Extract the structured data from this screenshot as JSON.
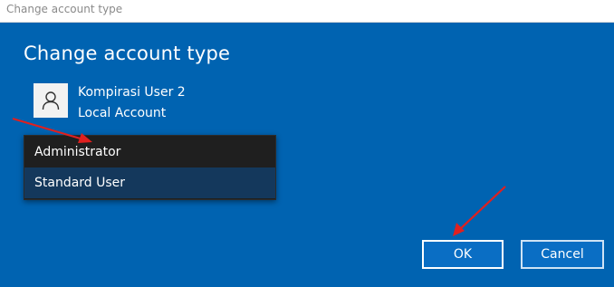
{
  "window": {
    "title": "Change account type"
  },
  "dialog": {
    "heading": "Change account type",
    "user": {
      "name": "Kompirasi User 2",
      "account_type": "Local Account",
      "avatar_icon": "person-icon"
    },
    "dropdown": {
      "options": [
        "Administrator",
        "Standard User"
      ],
      "selected": "Standard User"
    },
    "buttons": {
      "ok": "OK",
      "cancel": "Cancel"
    }
  },
  "colors": {
    "background": "#0063b1",
    "dropdown_bg": "#1f1f1f",
    "selected_option_bg": "#14385c",
    "annotation_arrow": "#e0201f"
  }
}
